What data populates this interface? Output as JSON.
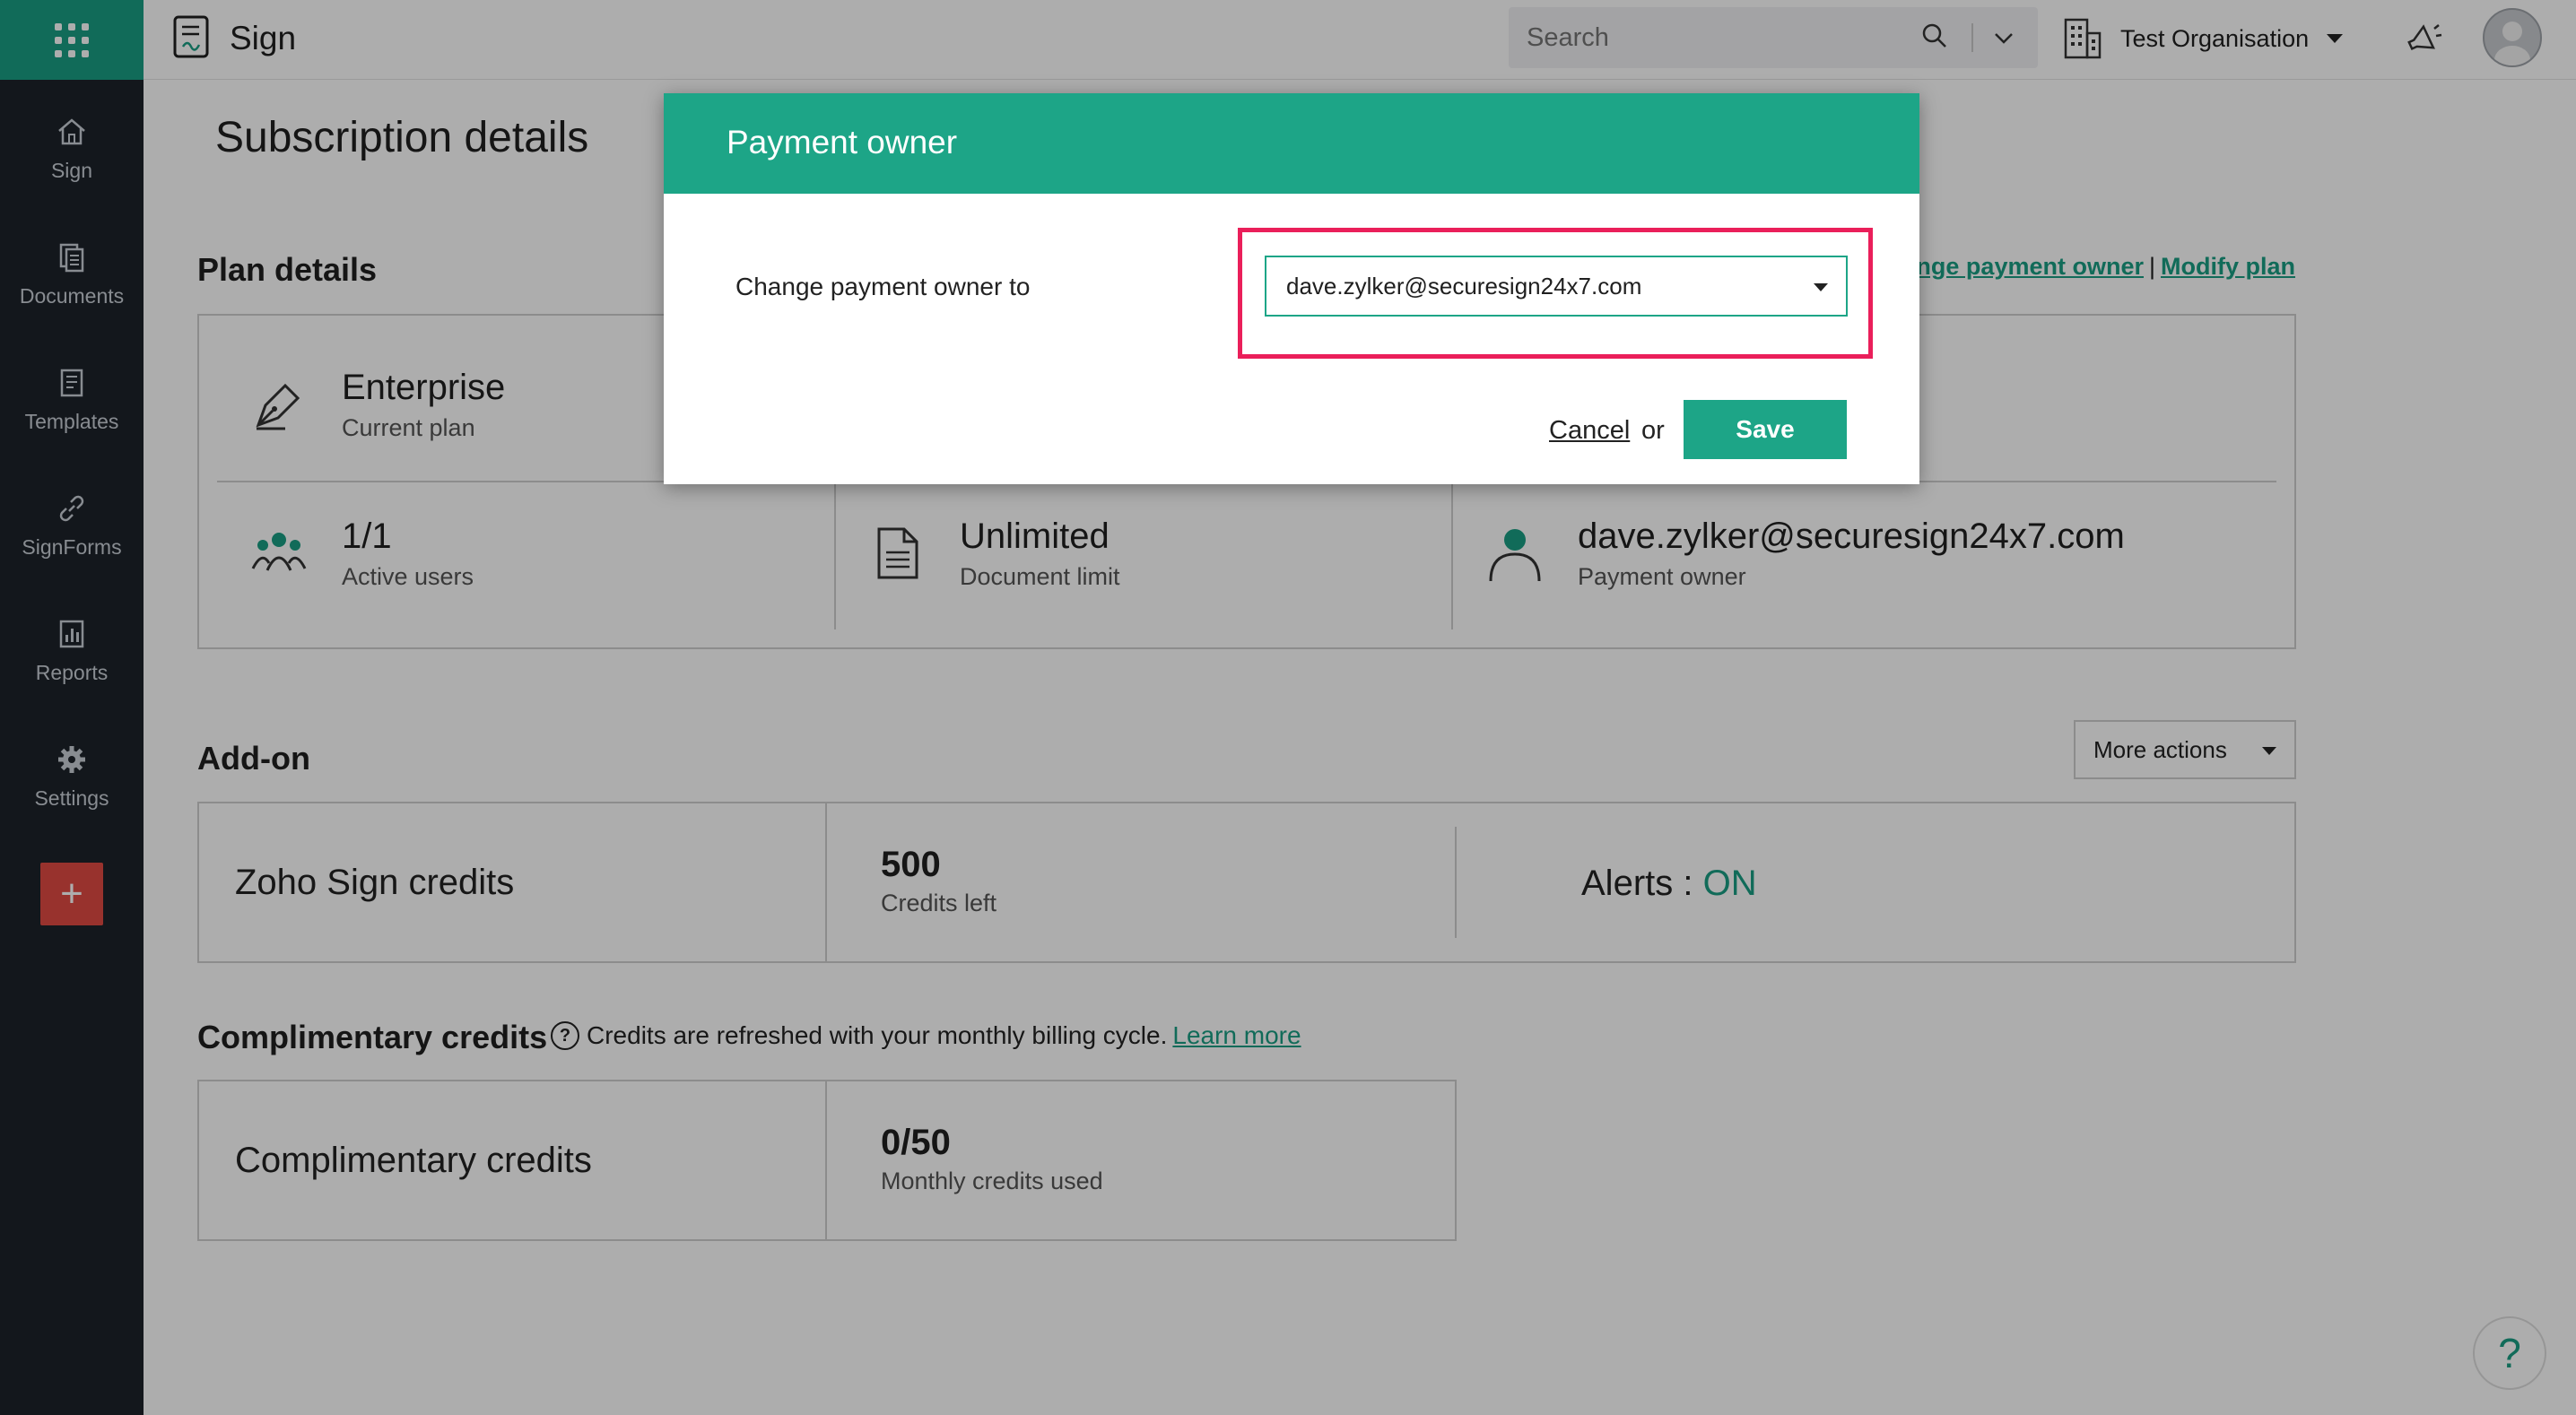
{
  "sidebar": {
    "items": [
      {
        "label": "Sign",
        "icon": "home-icon"
      },
      {
        "label": "Documents",
        "icon": "documents-icon"
      },
      {
        "label": "Templates",
        "icon": "templates-icon"
      },
      {
        "label": "SignForms",
        "icon": "link-icon"
      },
      {
        "label": "Reports",
        "icon": "reports-icon"
      },
      {
        "label": "Settings",
        "icon": "gear-icon"
      }
    ],
    "add_label": "+"
  },
  "header": {
    "app_name": "Sign",
    "search_placeholder": "Search",
    "org_name": "Test Organisation"
  },
  "main": {
    "page_title": "Subscription details",
    "plan_details": {
      "title": "Plan details",
      "links": {
        "change_owner": "Change payment owner",
        "modify_plan": "Modify plan",
        "separator": "|"
      },
      "plan_value": "Enterprise",
      "plan_label": "Current plan",
      "users_value": "1/1",
      "users_label": "Active users",
      "docs_value": "Unlimited",
      "docs_label": "Document limit",
      "owner_value": "dave.zylker@securesign24x7.com",
      "owner_label": "Payment owner"
    },
    "addon": {
      "title": "Add-on",
      "more_actions": "More actions",
      "name": "Zoho Sign credits",
      "credits_value": "500",
      "credits_label": "Credits left",
      "alerts_label": "Alerts :",
      "alerts_value": "ON"
    },
    "complimentary": {
      "title": "Complimentary credits",
      "info": "Credits are refreshed with your monthly billing cycle.",
      "learn_more": "Learn more",
      "name": "Complimentary credits",
      "used_value": "0/50",
      "used_label": "Monthly credits used"
    },
    "help": "?"
  },
  "modal": {
    "title": "Payment owner",
    "label": "Change payment owner to",
    "selected_owner": "dave.zylker@securesign24x7.com",
    "cancel": "Cancel",
    "or": "or",
    "save": "Save"
  },
  "colors": {
    "accent": "#1da587",
    "sidebar": "#1c222a",
    "highlight": "#ea1f5a",
    "add_button": "#e04a43"
  }
}
